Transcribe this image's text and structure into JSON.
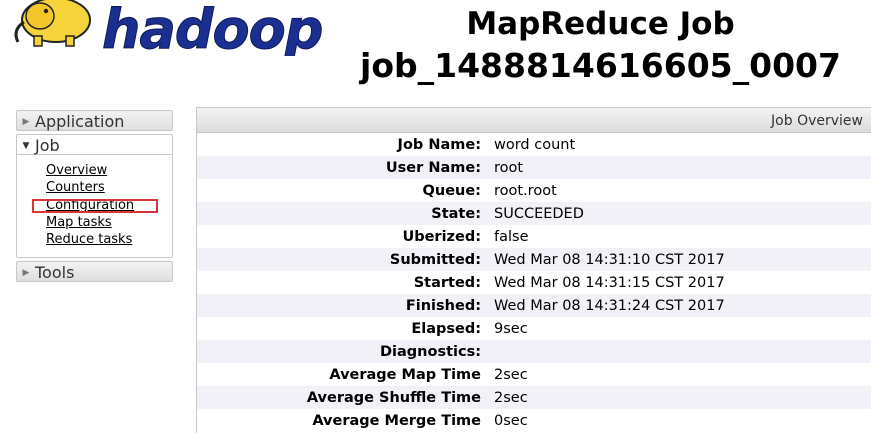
{
  "logo": {
    "text": "hadoop"
  },
  "header": {
    "title_line1": "MapReduce Job",
    "title_line2": "job_1488814616605_0007"
  },
  "sidebar": {
    "application": "Application",
    "job": "Job",
    "job_links": [
      "Overview",
      "Counters",
      "Configuration",
      "Map tasks",
      "Reduce tasks"
    ],
    "tools": "Tools"
  },
  "overview": {
    "header": "Job Overview",
    "rows": [
      {
        "key": "Job Name:",
        "value": "word count"
      },
      {
        "key": "User Name:",
        "value": "root"
      },
      {
        "key": "Queue:",
        "value": "root.root"
      },
      {
        "key": "State:",
        "value": "SUCCEEDED"
      },
      {
        "key": "Uberized:",
        "value": "false"
      },
      {
        "key": "Submitted:",
        "value": "Wed Mar 08 14:31:10 CST 2017"
      },
      {
        "key": "Started:",
        "value": "Wed Mar 08 14:31:15 CST 2017"
      },
      {
        "key": "Finished:",
        "value": "Wed Mar 08 14:31:24 CST 2017"
      },
      {
        "key": "Elapsed:",
        "value": "9sec"
      },
      {
        "key": "Diagnostics:",
        "value": ""
      },
      {
        "key": "Average Map Time",
        "value": "2sec"
      },
      {
        "key": "Average Shuffle Time",
        "value": "2sec"
      },
      {
        "key": "Average Merge Time",
        "value": "0sec"
      }
    ]
  },
  "colors": {
    "highlight": "#d9343a",
    "logo_blue": "#1a2f8f",
    "logo_yellow": "#f7d33b",
    "row_stripe": "#f1f1f7"
  }
}
